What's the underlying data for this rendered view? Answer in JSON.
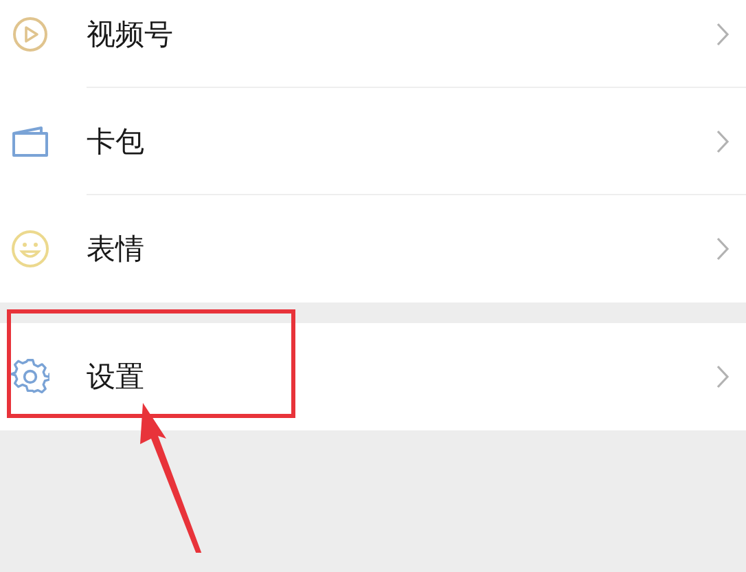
{
  "sections": [
    {
      "items": [
        {
          "label": "视频号",
          "highlighted": false
        },
        {
          "label": "卡包",
          "highlighted": false
        },
        {
          "label": "表情",
          "highlighted": false
        }
      ]
    },
    {
      "items": [
        {
          "label": "设置",
          "highlighted": true
        }
      ]
    }
  ]
}
